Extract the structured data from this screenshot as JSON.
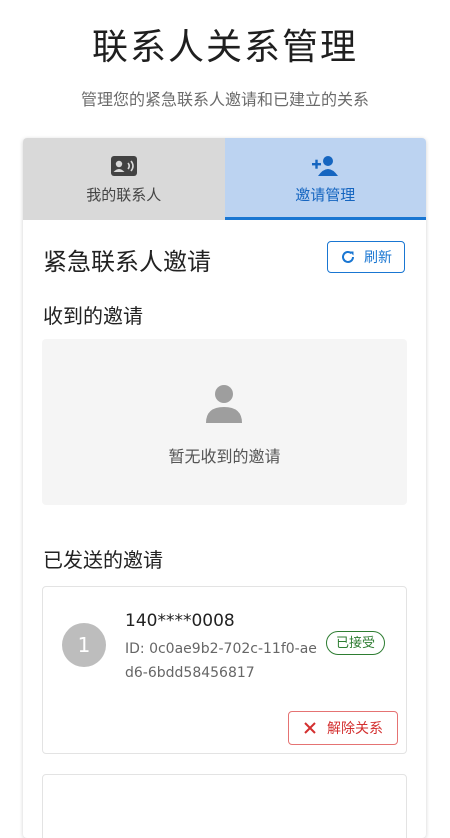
{
  "header": {
    "title": "联系人关系管理",
    "subtitle": "管理您的紧急联系人邀请和已建立的关系"
  },
  "tabs": [
    {
      "label": "我的联系人",
      "icon": "contact-card-icon",
      "active": false
    },
    {
      "label": "邀请管理",
      "icon": "person-add-icon",
      "active": true
    }
  ],
  "main": {
    "title": "紧急联系人邀请",
    "refresh_label": "刷新",
    "received": {
      "heading": "收到的邀请",
      "empty_text": "暂无收到的邀请"
    },
    "sent": {
      "heading": "已发送的邀请",
      "items": [
        {
          "avatar_text": "1",
          "phone": "140****0008",
          "id_text": "ID: 0c0ae9b2-702c-11f0-aed6-6bdd58456817",
          "status": "已接受",
          "action_label": "解除关系"
        }
      ]
    }
  },
  "colors": {
    "accent": "#1976d2",
    "active_tab_bg": "#bcd3f1",
    "inactive_tab_bg": "#d9d9d9",
    "success": "#2e7d32",
    "danger": "#d32f2f"
  }
}
